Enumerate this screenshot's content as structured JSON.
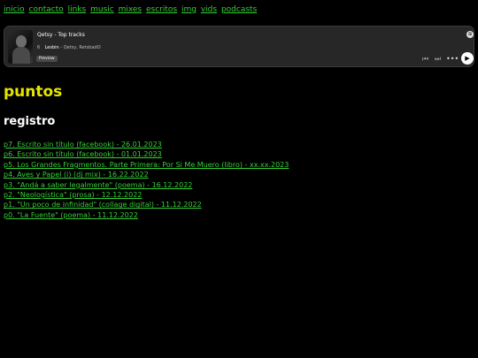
{
  "nav": [
    {
      "label": "inicio"
    },
    {
      "label": "contacto"
    },
    {
      "label": "links"
    },
    {
      "label": "music"
    },
    {
      "label": "mixes"
    },
    {
      "label": "escritos"
    },
    {
      "label": "img"
    },
    {
      "label": "vids"
    },
    {
      "label": "podcasts"
    }
  ],
  "player": {
    "title": "Qetsy - Top tracks",
    "track_number": "6",
    "track_name": "Lesbin",
    "track_artist": "- Qetsy, RetsbadO",
    "preview_label": "Preview",
    "icons": [
      "spotify-icon",
      "previous-icon",
      "next-icon",
      "more-icon",
      "play-icon"
    ]
  },
  "heading": "puntos",
  "subheading": "registro",
  "entries": [
    "p7. Escrito sin título (facebook) - 26.01.2023",
    "p6. Escrito sin título (facebook) - 01.01.2023",
    "p5. Los Grandes Fragmentos. Parte Primera: Por Si Me Muero (libro) - xx.xx.2023",
    "p4. Aves y Papel (i) (dj mix) - 16.22.2022",
    "p3. \"Andá a saber legalmente\" (poema) - 16.12.2022",
    "p2. \"Neologística\" (prosa) - 12.12.2022",
    "p1. \"Un poco de infinidad\" (collage digital) - 11.12.2022",
    "p0. \"La Fuente\" (poema) - 11.12.2022"
  ],
  "colors": {
    "link": "#35d035",
    "heading": "#e5e500",
    "background": "#000000",
    "player_bg": "#272727"
  }
}
